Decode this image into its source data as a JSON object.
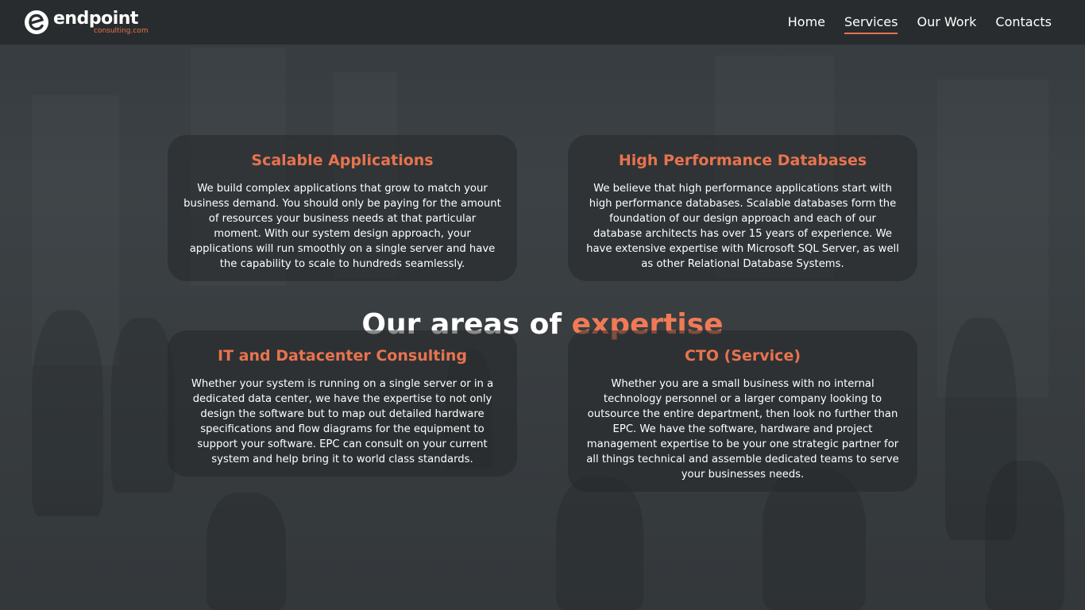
{
  "brand": {
    "name": "endpoint",
    "domain": "consulting.com",
    "accent_color": "#e8734f"
  },
  "nav": {
    "items": [
      {
        "label": "Home",
        "active": false
      },
      {
        "label": "Services",
        "active": true
      },
      {
        "label": "Our Work",
        "active": false
      },
      {
        "label": "Contacts",
        "active": false
      }
    ]
  },
  "section": {
    "heading_prefix": "Our areas of",
    "heading_accent": "expertise"
  },
  "cards": [
    {
      "title": "Scalable Applications",
      "text": "We build complex applications that grow to match your business demand. You should only be paying for the amount of resources your business needs at that particular moment. With our system design approach, your applications will run smoothly on a single server and have the capability to scale to hundreds seamlessly."
    },
    {
      "title": "High Performance Databases",
      "text": "We believe that high performance applications start with high performance databases. Scalable databases form the foundation of our design approach and each of our database architects has over 15 years of experience. We have extensive expertise with Microsoft SQL Server, as well as other Relational Database Systems."
    },
    {
      "title": "IT and Datacenter Consulting",
      "text": "Whether your system is running on a single server or in a dedicated data center, we have the expertise to not only design the software but to map out detailed hardware specifications and flow diagrams for the equipment to support your software. EPC can consult on your current system and help bring it to world class standards."
    },
    {
      "title": "CTO (Service)",
      "text": "Whether you are a small business with no internal technology personnel or a larger company looking to outsource the entire department, then look no further than EPC. We have the software, hardware and project management expertise to be your one strategic partner for all things technical and assemble dedicated teams to serve your businesses needs."
    }
  ]
}
